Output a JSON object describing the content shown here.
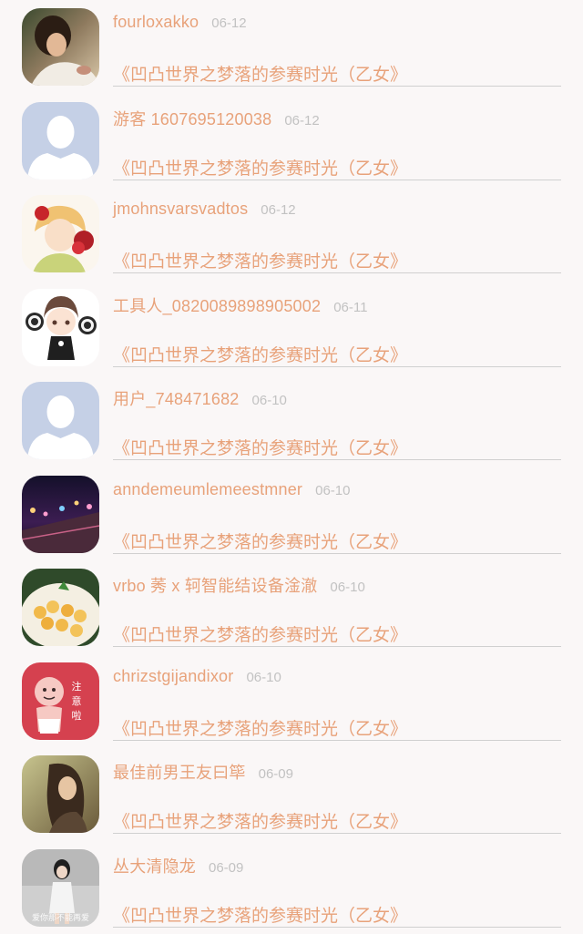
{
  "items": [
    {
      "avatar": "photo-woman-lying-icon",
      "username": "fourloxakko",
      "date": "06-12",
      "title": "《凹凸世界之梦落的参赛时光（乙女》"
    },
    {
      "avatar": "default-user-avatar-icon",
      "username": "游客 1607695120038",
      "date": "06-12",
      "title": "《凹凸世界之梦落的参赛时光（乙女》"
    },
    {
      "avatar": "anime-boy-with-roses-icon",
      "username": "jmohnsvarsvadtos",
      "date": "06-12",
      "title": "《凹凸世界之梦落的参赛时光（乙女》"
    },
    {
      "avatar": "cartoon-girl-with-cookies-icon",
      "username": "工具人_0820089898905002",
      "date": "06-11",
      "title": "《凹凸世界之梦落的参赛时光（乙女》"
    },
    {
      "avatar": "default-user-avatar-icon",
      "username": "用户_748471682",
      "date": "06-10",
      "title": "《凹凸世界之梦落的参赛时光（乙女》"
    },
    {
      "avatar": "night-street-lights-icon",
      "username": "anndemeumlemeestmner",
      "date": "06-10",
      "title": "《凹凸世界之梦落的参赛时光（乙女》"
    },
    {
      "avatar": "food-plate-icon",
      "username": "vrbo 莠 x 轲智能结设备淦澈",
      "date": "06-10",
      "title": "《凹凸世界之梦落的参赛时光（乙女》"
    },
    {
      "avatar": "baby-cartoon-sticker-icon",
      "username": "chrizstgijandixor",
      "date": "06-10",
      "title": "《凹凸世界之梦落的参赛时光（乙女》"
    },
    {
      "avatar": "girl-portrait-sepia-icon",
      "username": "最佳前男王友曰筚",
      "date": "06-09",
      "title": "《凹凸世界之梦落的参赛时光（乙女》"
    },
    {
      "avatar": "girl-standing-photo-icon",
      "username": "丛大清隐龙",
      "date": "06-09",
      "title": "《凹凸世界之梦落的参赛时光（乙女》"
    }
  ],
  "avatar_text": {
    "sticker_text": "注意啦",
    "photo_caption": "爱你那不能再爱"
  },
  "colors": {
    "background": "#faf7f7",
    "username": "#e8a27a",
    "title": "#e8a27a",
    "date": "#c2c2c2",
    "divider": "#d0d0d0",
    "default_avatar_bg": "#c5d0e6"
  }
}
